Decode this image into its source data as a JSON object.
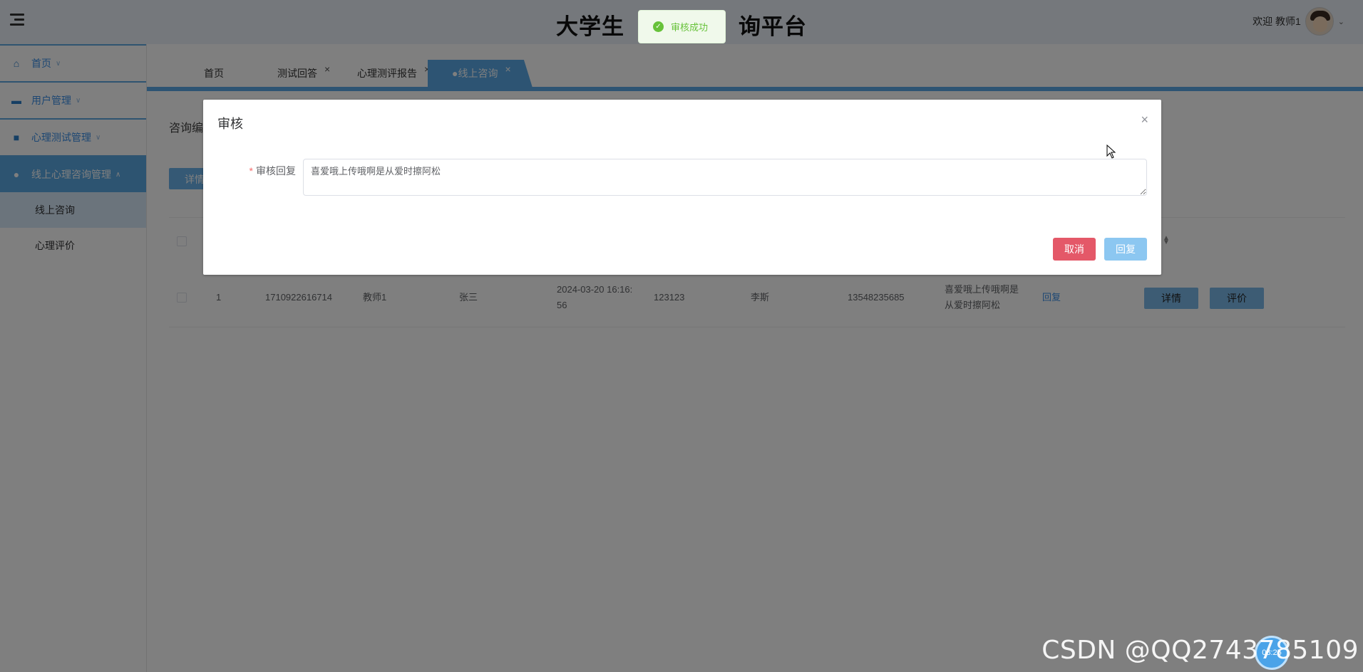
{
  "header": {
    "title_left": "大学生",
    "title_right": "询平台",
    "welcome": "欢迎 教师1"
  },
  "sidebar": {
    "items": [
      {
        "label": "首页",
        "icon": "home-icon"
      },
      {
        "label": "用户管理",
        "icon": "user-card-icon"
      },
      {
        "label": "心理测试管理",
        "icon": "book-icon"
      },
      {
        "label": "线上心理咨询管理",
        "icon": "chat-icon"
      }
    ],
    "subitems": [
      {
        "label": "线上咨询"
      },
      {
        "label": "心理评价"
      }
    ]
  },
  "tabs": [
    {
      "label": "首页"
    },
    {
      "label": "测试回答"
    },
    {
      "label": "心理测评报告"
    },
    {
      "label": "●线上咨询"
    }
  ],
  "main": {
    "filter_label": "咨询编",
    "detail_button": "详情",
    "row": {
      "index": "1",
      "id": "1710922616714",
      "teacher": "教师1",
      "student": "张三",
      "time_line1": "2024-03-20 16:16:",
      "time_line2": "56",
      "code": "123123",
      "name": "李斯",
      "phone": "13548235685",
      "content_line1": "喜爱哦上传哦啊是",
      "content_line2": "从爱时擦阿松",
      "reply_link": "回复",
      "detail_btn": "详情",
      "eval_btn": "评价"
    }
  },
  "dialog": {
    "title": "审核",
    "close": "×",
    "field_label": "审核回复",
    "field_value": "喜爱哦上传哦啊是从爱时擦阿松",
    "cancel": "取消",
    "submit": "回复"
  },
  "toast": {
    "message": "审核成功"
  },
  "watermark": "CSDN @QQ2743785109",
  "float_ball": "08:25"
}
